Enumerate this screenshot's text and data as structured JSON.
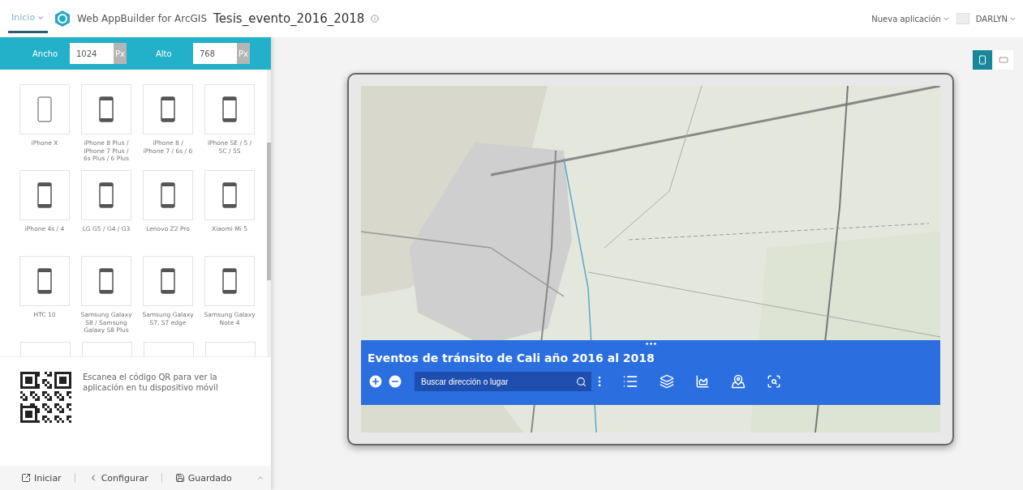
{
  "header": {
    "home_tab": {
      "label": "Inicio",
      "selected": true
    },
    "product": "Web AppBuilder for ArcGIS",
    "app_title": "Tesis_evento_2016_2018",
    "new_app": "Nueva aplicación",
    "user": "DARLYN"
  },
  "size_bar": {
    "width_label": "Ancho",
    "width_value": "1024",
    "width_unit": "Px",
    "height_label": "Alto",
    "height_value": "768",
    "height_unit": "Px"
  },
  "devices": [
    {
      "name": "iPhone X",
      "kind": "frameless"
    },
    {
      "name": "iPhone 8 Plus / iPhone 7 Plus / 6s Plus / 6 Plus",
      "kind": "bezel"
    },
    {
      "name": "iPhone 8 / iPhone 7 / 6s / 6",
      "kind": "bezel"
    },
    {
      "name": "iPhone SE / 5 / 5C / 5S",
      "kind": "bezel"
    },
    {
      "name": "iPhone 4s / 4",
      "kind": "bezel"
    },
    {
      "name": "LG G5 / G4 / G3",
      "kind": "bezel"
    },
    {
      "name": "Lenovo Z2 Pro",
      "kind": "bezel"
    },
    {
      "name": "Xiaomi Mi 5",
      "kind": "bezel"
    },
    {
      "name": "HTC 10",
      "kind": "bezel"
    },
    {
      "name": "Samsung Galaxy S8 / Samsung Galaxy S8 Plus",
      "kind": "bezel"
    },
    {
      "name": "Samsung Galaxy S7, S7 edge",
      "kind": "bezel"
    },
    {
      "name": "Samsung Galaxy Note 4",
      "kind": "bezel"
    },
    {
      "kind": "cut"
    },
    {
      "kind": "cut"
    },
    {
      "kind": "cut"
    },
    {
      "kind": "cut"
    }
  ],
  "qr": {
    "text": "Escanea el código QR para ver la aplicación en tu dispositivo móvil"
  },
  "footer": {
    "launch": "Iniciar",
    "configure": "Configurar",
    "saved": "Guardado"
  },
  "orientation": [
    {
      "kind": "portrait",
      "selected": true
    },
    {
      "kind": "landscape",
      "selected": false
    }
  ],
  "app": {
    "kind": "picture",
    "title": "Eventos de tránsito de Cali año 2016 al 2018",
    "search_placeholder": "Buscar dirección o lugar"
  }
}
